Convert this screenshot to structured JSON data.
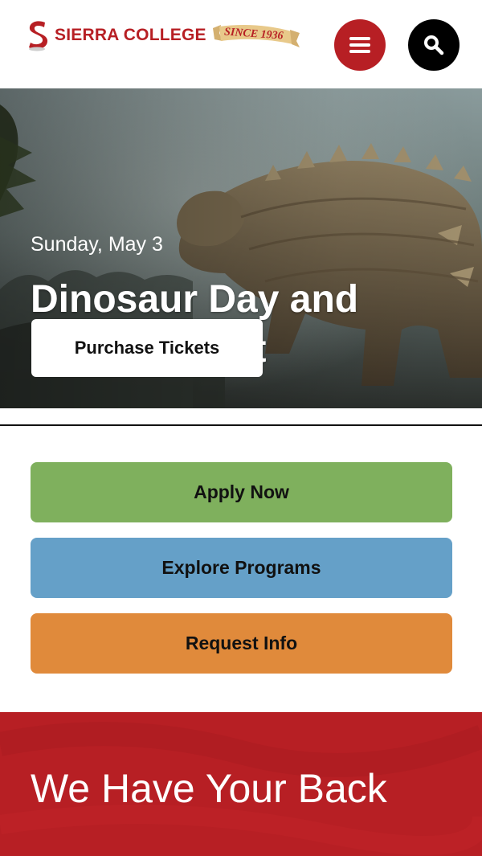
{
  "header": {
    "logo_text": "SIERRA COLLEGE",
    "logo_ribbon_text": "SINCE 1936",
    "menu_icon": "hamburger-icon",
    "search_icon": "search-icon"
  },
  "hero": {
    "date": "Sunday, May 3",
    "title": "Dinosaur Day and Science Fest",
    "button_label": "Purchase Tickets"
  },
  "cta": {
    "apply_label": "Apply Now",
    "explore_label": "Explore Programs",
    "request_label": "Request Info"
  },
  "red_section": {
    "title": "We Have Your Back"
  },
  "colors": {
    "brand_red": "#b71f24",
    "apply_green": "#7fb05d",
    "explore_blue": "#65a0c8",
    "request_orange": "#e08a3b",
    "ribbon_gold": "#e8c98a"
  }
}
